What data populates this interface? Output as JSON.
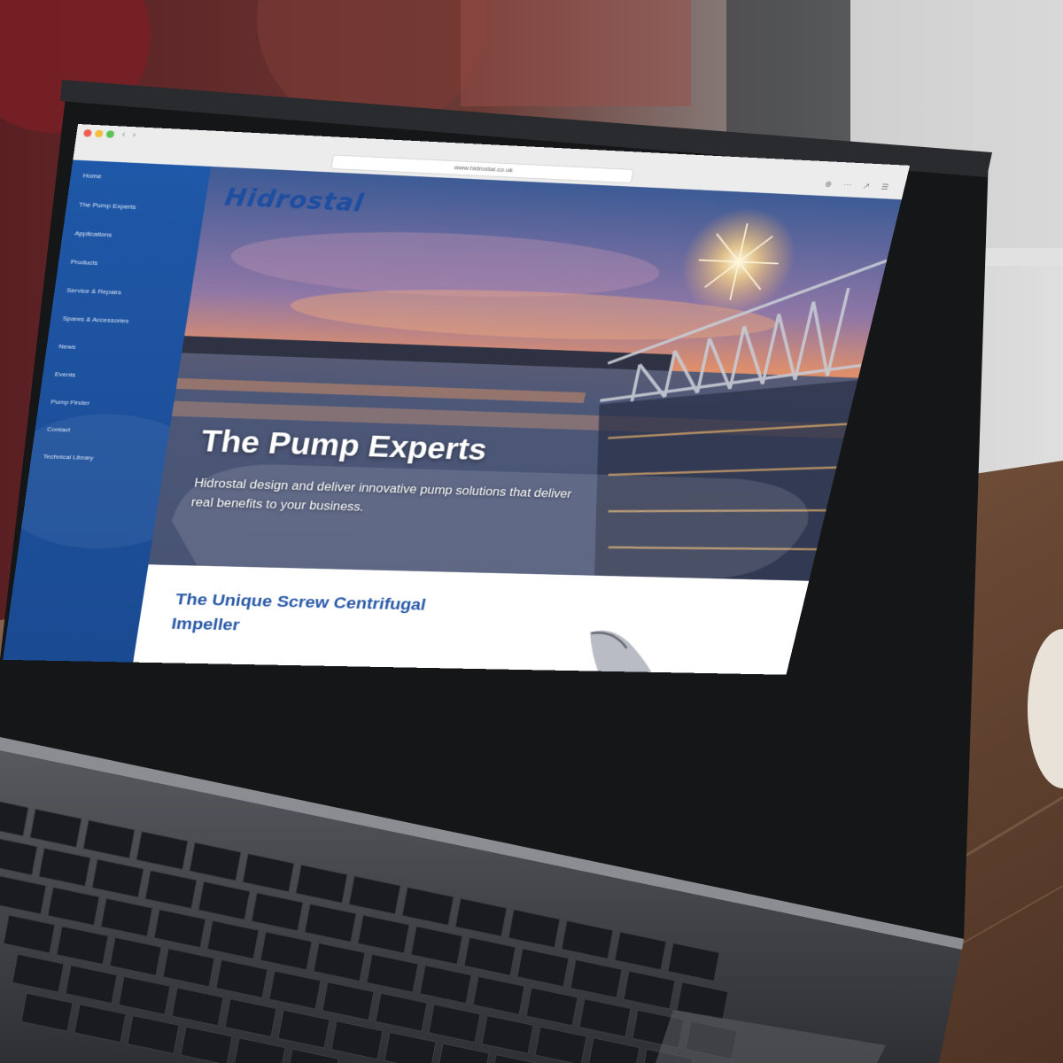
{
  "browser": {
    "url": "www.hidrostal.co.uk",
    "nav_back": "‹",
    "nav_forward": "›",
    "tools": "⊕ ⋯ ↗ ☰"
  },
  "brand": {
    "logo": "Hidrostal",
    "accent": "#1f58a8",
    "title_color": "#2a5aa8"
  },
  "sidebar": {
    "items": [
      {
        "label": "Home"
      },
      {
        "label": "The Pump Experts"
      },
      {
        "label": "Applications"
      },
      {
        "label": "Products"
      },
      {
        "label": "Service & Repairs"
      },
      {
        "label": "Spares & Accessories"
      },
      {
        "label": "News"
      },
      {
        "label": "Events"
      },
      {
        "label": "Pump Finder"
      },
      {
        "label": "Contact"
      },
      {
        "label": "Technical Library"
      }
    ]
  },
  "hero": {
    "title": "The Pump Experts",
    "text": "Hidrostal design and deliver innovative pump solutions that deliver real benefits to your business."
  },
  "section": {
    "title": "The Unique Screw Centrifugal Impeller"
  }
}
